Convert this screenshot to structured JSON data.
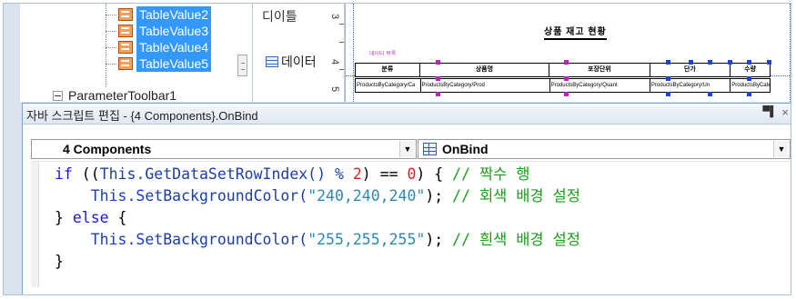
{
  "tree": {
    "items": [
      "TableValue2",
      "TableValue3",
      "TableValue4",
      "TableValue5"
    ],
    "parameter_item": "ParameterToolbar1"
  },
  "middle": {
    "label_top": "디이틀",
    "label_data": "데이터"
  },
  "ruler": {
    "numbers": [
      "3",
      "4",
      "5"
    ]
  },
  "report": {
    "title": "상품 재고 현황",
    "small_label": "데이터 목록",
    "headers": [
      "분류",
      "상품명",
      "포장단위",
      "단가",
      "수량"
    ],
    "row_text": [
      "ProductsByCategory/Ca",
      "ProductsByCategory/Prod",
      "ProductsByCategory/Quant",
      "ProductsByCategory/Un",
      "ProductsByCategory/Un"
    ]
  },
  "panel": {
    "title": "자바 스크립트 편집 - {4 Components}.OnBind",
    "pin": "ᵖ",
    "close": "×",
    "component_select": "4 Components",
    "event_select": "OnBind"
  },
  "code": {
    "line1_kw": "if",
    "line1_a": " ((",
    "line1_this": "This",
    "line1_fn": ".GetDataSetRowIndex() % ",
    "line1_num": "2",
    "line1_b": ") == ",
    "line1_num2": "0",
    "line1_c": ") { ",
    "line1_comment": "// 짝수 행",
    "line2_this": "This",
    "line2_fn": ".SetBackgroundColor(",
    "line2_str": "\"240,240,240\"",
    "line2_end": "); ",
    "line2_comment": "// 회색 배경 설정",
    "line3_a": "} ",
    "line3_kw": "else",
    "line3_b": " {",
    "line4_this": "This",
    "line4_fn": ".SetBackgroundColor(",
    "line4_str": "\"255,255,255\"",
    "line4_end": "); ",
    "line4_comment": "// 흰색 배경 설정",
    "line5": "}"
  },
  "colors": {
    "selection": "#3399ff",
    "keyword": "#1b18e0",
    "string": "#2a8bb0",
    "number": "#e02020",
    "comment": "#1a9e1a"
  }
}
